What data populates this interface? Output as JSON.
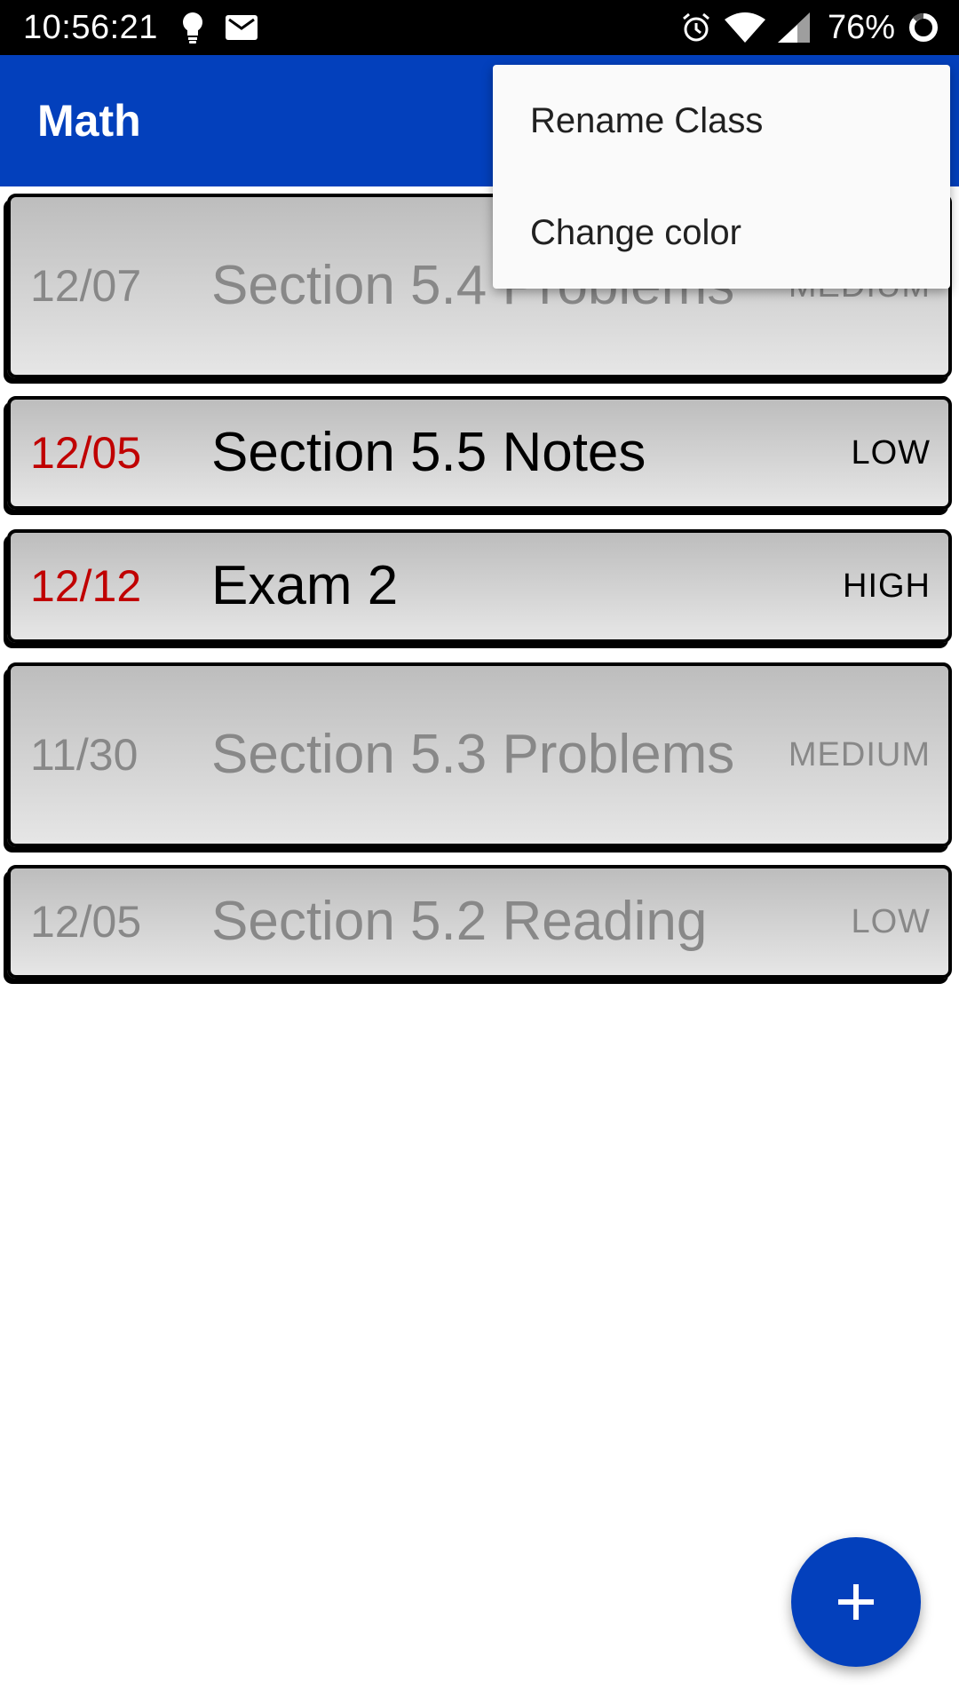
{
  "status_bar": {
    "time": "10:56:21",
    "battery": "76%",
    "left_icons": [
      "lightbulb-icon",
      "mail-icon"
    ],
    "right_icons": [
      "alarm-icon",
      "wifi-icon",
      "cell-signal-icon",
      "battery-ring-icon"
    ]
  },
  "app_bar": {
    "title": "Math",
    "color": "#0340BC"
  },
  "menu": {
    "items": [
      {
        "label": "Rename Class"
      },
      {
        "label": "Change color"
      }
    ]
  },
  "tasks": [
    {
      "date": "12/07",
      "title": "Section 5.4 Problems",
      "priority": "MEDIUM",
      "state": "done"
    },
    {
      "date": "12/05",
      "title": "Section 5.5 Notes",
      "priority": "LOW",
      "state": "active"
    },
    {
      "date": "12/12",
      "title": "Exam 2",
      "priority": "HIGH",
      "state": "active"
    },
    {
      "date": "11/30",
      "title": "Section 5.3 Problems",
      "priority": "MEDIUM",
      "state": "done"
    },
    {
      "date": "12/05",
      "title": "Section 5.2 Reading",
      "priority": "LOW",
      "state": "done"
    }
  ],
  "fab": {
    "icon": "plus-icon",
    "color": "#0340BC"
  },
  "colors": {
    "overdue_date": "#C00000",
    "completed_text": "#888888"
  }
}
